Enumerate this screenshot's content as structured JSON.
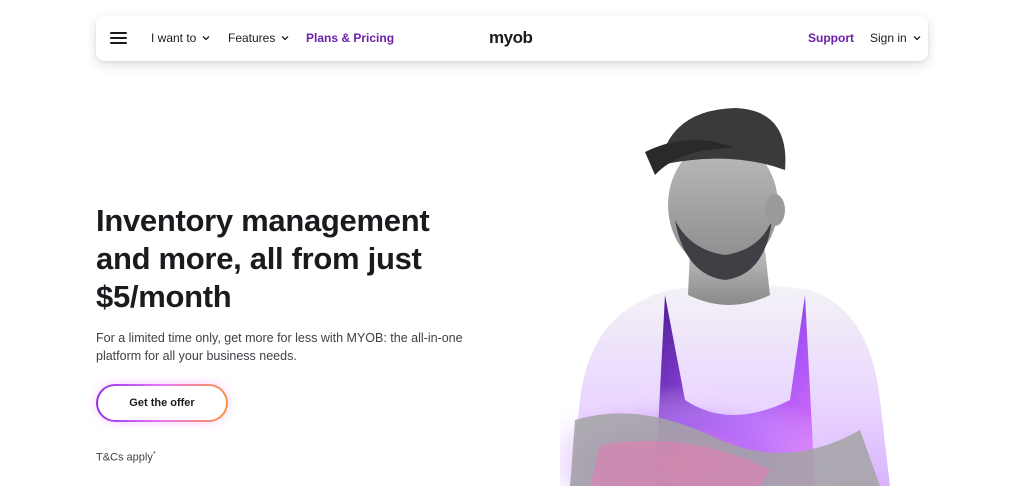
{
  "nav": {
    "menu_icon": "hamburger-icon",
    "i_want_to": "I want to",
    "features": "Features",
    "plans_pricing": "Plans & Pricing",
    "logo": "myob",
    "support": "Support",
    "sign_in": "Sign in"
  },
  "hero": {
    "title": "Inventory management and more, all from just $5/month",
    "description": "For a limited time only, get more for less with MYOB: the all-in-one platform for all your business needs.",
    "cta": "Get the offer",
    "terms": "T&Cs apply",
    "terms_mark": "*"
  },
  "colors": {
    "brand_purple": "#6b21a8",
    "text": "#1b1b1f",
    "cta_gradient": [
      "#9333ea",
      "#e879f9",
      "#fb923c"
    ]
  }
}
